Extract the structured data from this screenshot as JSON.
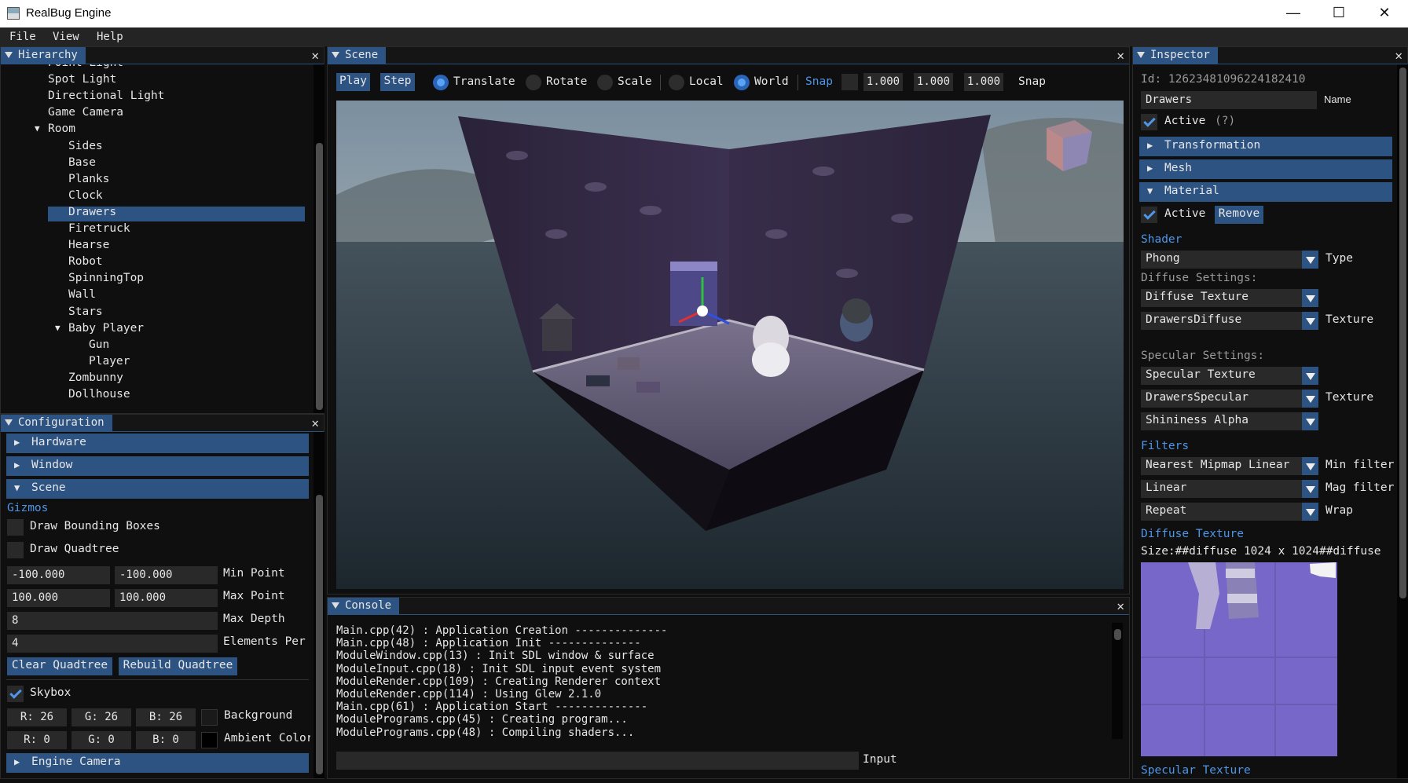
{
  "window": {
    "title": "RealBug Engine"
  },
  "menu": [
    "File",
    "View",
    "Help"
  ],
  "hierarchy": {
    "title": "Hierarchy",
    "items": [
      {
        "label": "Point Light",
        "level": 0
      },
      {
        "label": "Spot Light",
        "level": 0
      },
      {
        "label": "Directional Light",
        "level": 0
      },
      {
        "label": "Game Camera",
        "level": 0
      },
      {
        "label": "Room",
        "level": 0,
        "expanded": true
      },
      {
        "label": "Sides",
        "level": 1
      },
      {
        "label": "Base",
        "level": 1
      },
      {
        "label": "Planks",
        "level": 1
      },
      {
        "label": "Clock",
        "level": 1
      },
      {
        "label": "Drawers",
        "level": 1,
        "selected": true
      },
      {
        "label": "Firetruck",
        "level": 1
      },
      {
        "label": "Hearse",
        "level": 1
      },
      {
        "label": "Robot",
        "level": 1
      },
      {
        "label": "SpinningTop",
        "level": 1
      },
      {
        "label": "Wall",
        "level": 1
      },
      {
        "label": "Stars",
        "level": 1
      },
      {
        "label": "Baby Player",
        "level": 1,
        "expanded": true
      },
      {
        "label": "Gun",
        "level": 2
      },
      {
        "label": "Player",
        "level": 2
      },
      {
        "label": "Zombunny",
        "level": 1
      },
      {
        "label": "Dollhouse",
        "level": 1
      }
    ]
  },
  "configuration": {
    "title": "Configuration",
    "hardware": "Hardware",
    "window": "Window",
    "scene": "Scene",
    "gizmos": "Gizmos",
    "draw_bb": "Draw Bounding Boxes",
    "draw_qt": "Draw Quadtree",
    "min_x": "-100.000",
    "min_y": "-100.000",
    "min_label": "Min Point",
    "max_x": "100.000",
    "max_y": "100.000",
    "max_label": "Max Point",
    "max_depth": "8",
    "max_depth_label": "Max Depth",
    "elements": "4",
    "elements_label": "Elements Per",
    "clear_qt": "Clear Quadtree",
    "rebuild_qt": "Rebuild Quadtree",
    "skybox": "Skybox",
    "bg_r": "R: 26",
    "bg_g": "G: 26",
    "bg_b": "B: 26",
    "bg_label": "Background",
    "amb_r": "R:  0",
    "amb_g": "G:  0",
    "amb_b": "B:  0",
    "amb_label": "Ambient Color",
    "engine_camera": "Engine Camera",
    "bg_color": "#1a1a1a",
    "amb_color": "#000000"
  },
  "scene": {
    "title": "Scene",
    "play": "Play",
    "step": "Step",
    "translate": "Translate",
    "rotate": "Rotate",
    "scale": "Scale",
    "local": "Local",
    "world": "World",
    "snap_btn": "Snap",
    "snap1": "1.000",
    "snap2": "1.000",
    "snap3": "1.000",
    "snap_label": "Snap"
  },
  "console": {
    "title": "Console",
    "lines": [
      "Main.cpp(42) : Application Creation --------------",
      "Main.cpp(48) : Application Init --------------",
      "ModuleWindow.cpp(13) : Init SDL window & surface",
      "ModuleInput.cpp(18) : Init SDL input event system",
      "ModuleRender.cpp(109) : Creating Renderer context",
      "ModuleRender.cpp(114) : Using Glew 2.1.0",
      "Main.cpp(61) : Application Start --------------",
      "ModulePrograms.cpp(45) : Creating program...",
      "ModulePrograms.cpp(48) : Compiling shaders..."
    ],
    "input_label": "Input"
  },
  "inspector": {
    "title": "Inspector",
    "id": "Id: 12623481096224182410",
    "name_value": "Drawers",
    "name_label": "Name",
    "active": "Active",
    "help": "(?)",
    "transformation": "Transformation",
    "mesh": "Mesh",
    "material": "Material",
    "mat_active": "Active",
    "remove": "Remove",
    "shader": "Shader",
    "shader_value": "Phong",
    "type_label": "Type",
    "diffuse_settings": "Diffuse Settings:",
    "diffuse_texture_combo": "Diffuse Texture",
    "diffuse_tex": "DrawersDiffuse",
    "texture_label": "Texture",
    "specular_settings": "Specular Settings:",
    "specular_texture_combo": "Specular Texture",
    "specular_tex": "DrawersSpecular",
    "texture_label2": "Texture",
    "shininess": "Shininess Alpha",
    "filters": "Filters",
    "min_filter": "Nearest Mipmap Linear",
    "min_filter_label": "Min filter",
    "mag_filter": "Linear",
    "mag_filter_label": "Mag filter",
    "wrap": "Repeat",
    "wrap_label": "Wrap",
    "diffuse_texture_title": "Diffuse Texture",
    "size": "Size:##diffuse 1024 x 1024##diffuse",
    "specular_texture_title": "Specular Texture"
  },
  "colors": {
    "accent": "#2d5383",
    "link": "#4d96e8"
  }
}
